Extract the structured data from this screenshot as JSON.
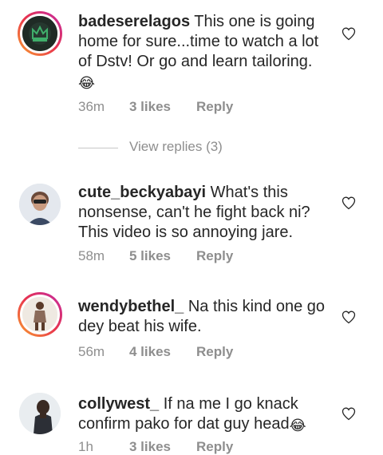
{
  "comments": [
    {
      "username": "badeserelagos",
      "text": " This one is going home for sure...time to watch a lot of Dstv! Or go and learn tailoring.",
      "emoji": "😂",
      "time": "36m",
      "likes": "3 likes",
      "reply": "Reply",
      "view_replies": "View replies (3)"
    },
    {
      "username": "cute_beckyabayi",
      "text": " What's this nonsense, can't he fight back ni? This video is so annoying jare.",
      "emoji": "",
      "time": "58m",
      "likes": "5 likes",
      "reply": "Reply"
    },
    {
      "username": "wendybethel_",
      "text": " Na this kind one go dey beat his wife.",
      "emoji": "",
      "time": "56m",
      "likes": "4 likes",
      "reply": "Reply"
    },
    {
      "username": "collywest_",
      "text": " If na me I go knack confirm pako for dat guy head",
      "emoji": "😂",
      "time": "1h",
      "likes": "3 likes",
      "reply": "Reply"
    }
  ],
  "colors": {
    "text": "#262626",
    "secondary": "#8e8e8e",
    "story_ring_start": "#f9a12e",
    "story_ring_end": "#c32aa3"
  },
  "icons": {
    "like": "heart-outline-icon"
  }
}
